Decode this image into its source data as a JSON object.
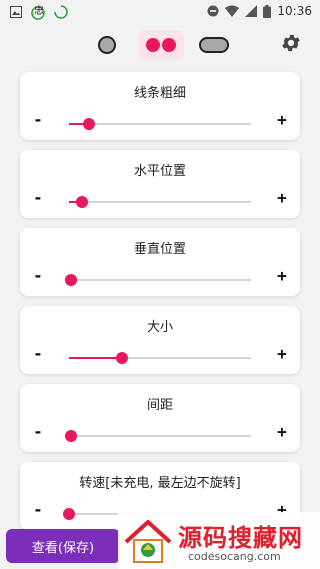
{
  "status_bar": {
    "time": "10:36",
    "left_icons": [
      "image-icon",
      "app-icon",
      "loading-ring-icon"
    ],
    "right_icons": [
      "dnd-icon",
      "wifi-icon",
      "signal-icon",
      "battery-icon"
    ]
  },
  "mode_bar": {
    "modes": [
      "single-dot-mode",
      "double-dot-mode",
      "pill-mode"
    ],
    "selected": "double-dot-mode",
    "settings_icon": "gear-icon"
  },
  "colors": {
    "accent": "#e8195a",
    "button": "#7b2fb8",
    "selected_mode_bg": "#fbe3ea"
  },
  "sliders": [
    {
      "title": "线条粗细",
      "minus": "-",
      "plus": "+",
      "value": 0.11
    },
    {
      "title": "水平位置",
      "minus": "-",
      "plus": "+",
      "value": 0.07
    },
    {
      "title": "垂直位置",
      "minus": "-",
      "plus": "+",
      "value": 0.01
    },
    {
      "title": "大小",
      "minus": "-",
      "plus": "+",
      "value": 0.29
    },
    {
      "title": "间距",
      "minus": "-",
      "plus": "+",
      "value": 0.01
    },
    {
      "title": "转速[未充电, 最左边不旋转]",
      "minus": "-",
      "plus": "+",
      "value": 0.0
    }
  ],
  "bottom_button": {
    "label": "查看(保存)"
  },
  "watermark": {
    "title": "源码搜藏网",
    "subtitle": "codesocang.com"
  }
}
